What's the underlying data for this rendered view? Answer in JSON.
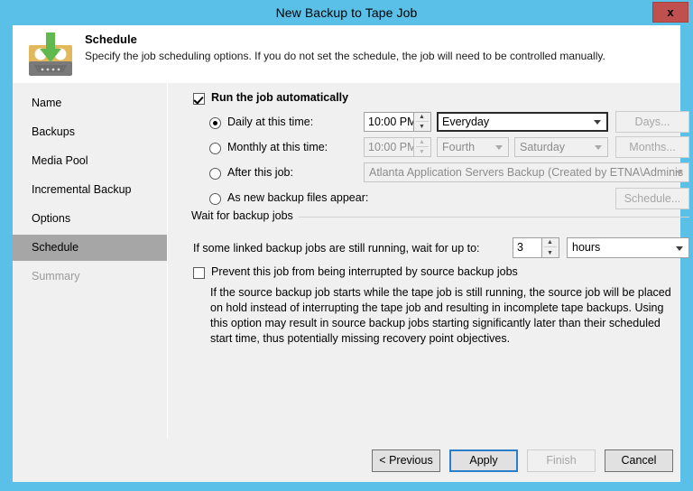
{
  "window": {
    "title": "New Backup to Tape Job",
    "close_label": "x"
  },
  "header": {
    "title": "Schedule",
    "subtitle": "Specify the job scheduling options. If you do not set the schedule, the job will need to be controlled manually.",
    "icon": "tape-cassette-download-icon"
  },
  "sidebar": {
    "items": [
      {
        "label": "Name",
        "state": "normal"
      },
      {
        "label": "Backups",
        "state": "normal"
      },
      {
        "label": "Media Pool",
        "state": "normal"
      },
      {
        "label": "Incremental Backup",
        "state": "normal"
      },
      {
        "label": "Options",
        "state": "normal"
      },
      {
        "label": "Schedule",
        "state": "selected"
      },
      {
        "label": "Summary",
        "state": "disabled"
      }
    ]
  },
  "schedule": {
    "run_automatically": {
      "label": "Run the job automatically",
      "checked": true
    },
    "daily": {
      "label": "Daily at this time:",
      "selected": true,
      "time_value": "10:00 PM",
      "period_value": "Everyday",
      "days_button": "Days..."
    },
    "monthly": {
      "label": "Monthly at this time:",
      "selected": false,
      "time_value": "10:00 PM",
      "week_value": "Fourth",
      "day_value": "Saturday",
      "months_button": "Months..."
    },
    "after_job": {
      "label": "After this job:",
      "selected": false,
      "job_value": "Atlanta Application Servers Backup (Created by ETNA\\Adminis"
    },
    "as_new_files": {
      "label": "As new backup files appear:",
      "selected": false,
      "schedule_button": "Schedule..."
    }
  },
  "wait_group": {
    "title": "Wait for backup jobs",
    "wait_label": "If some linked backup jobs are still running, wait for up to:",
    "wait_value": "3",
    "wait_units": "hours",
    "prevent": {
      "label": "Prevent this job from being interrupted by source backup jobs",
      "checked": false
    },
    "description": "If the source backup job starts while the tape job is still running, the source job will be placed on hold instead of interrupting the tape job and resulting in incomplete tape backups. Using this option may result in source backup jobs starting significantly later than their scheduled start time, thus potentially missing recovery point objectives."
  },
  "footer": {
    "previous": "< Previous",
    "apply": "Apply",
    "finish": "Finish",
    "cancel": "Cancel"
  },
  "colors": {
    "titlebar": "#5bc0e8",
    "close": "#c0504d",
    "selected_nav": "#a6a6a6",
    "panel": "#f0f0f0"
  }
}
